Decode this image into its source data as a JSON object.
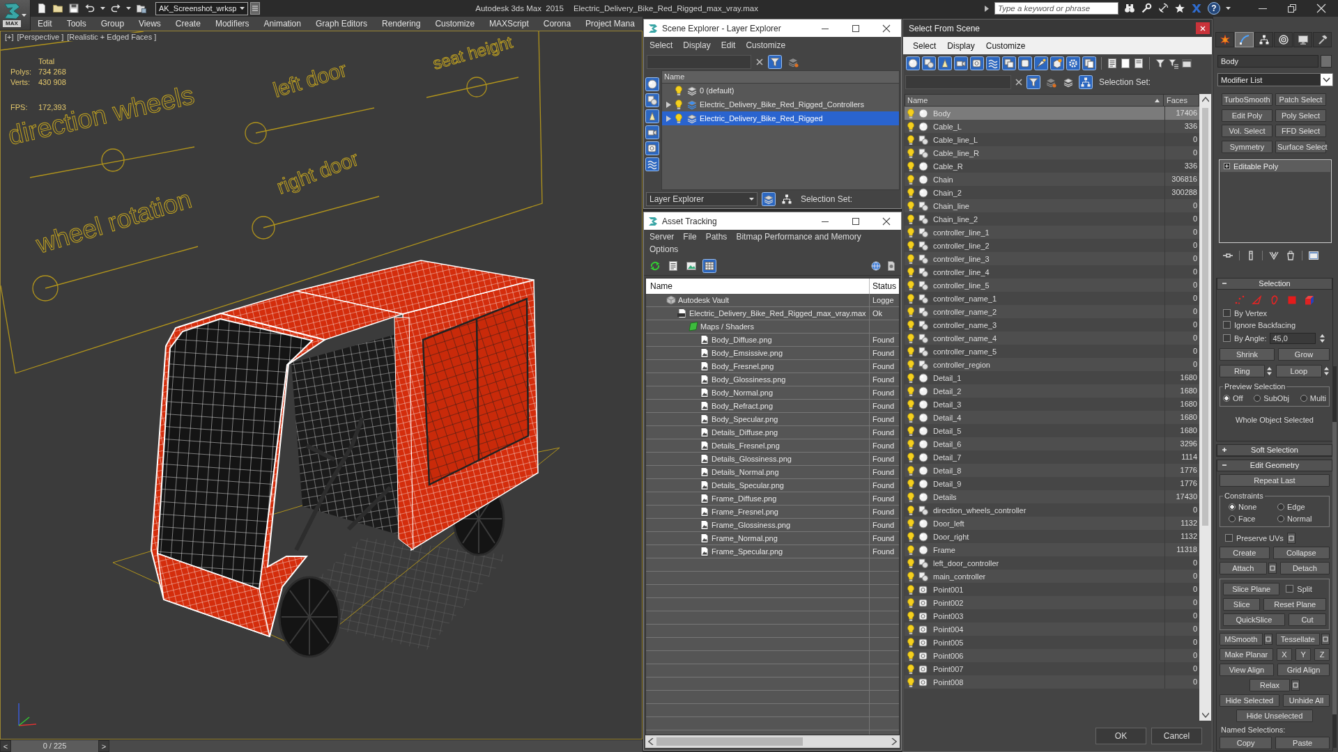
{
  "app_bar": {
    "logo_label": "MAX",
    "workspace": "AK_Screenshot_wrksp",
    "app_title": "Autodesk 3ds Max  2015",
    "file_title": "Electric_Delivery_Bike_Red_Rigged_max_vray.max",
    "search": {
      "placeholder": "Type a keyword or phrase"
    },
    "help": "?"
  },
  "menu": [
    "Edit",
    "Tools",
    "Group",
    "Views",
    "Create",
    "Modifiers",
    "Animation",
    "Graph Editors",
    "Rendering",
    "Customize",
    "MAXScript",
    "Corona",
    "Project Mana"
  ],
  "viewport": {
    "labels": [
      "[+]",
      "[Perspective ]",
      "[Realistic + Edged Faces ]"
    ],
    "stats": {
      "heading": "Total",
      "rows": [
        {
          "label": "Polys:",
          "value": "734 268"
        },
        {
          "label": "Verts:",
          "value": "430 908"
        },
        {
          "label": "FPS:",
          "value": "172,393"
        }
      ]
    },
    "scene_controls": [
      {
        "label": "direction wheels"
      },
      {
        "label": "left door"
      },
      {
        "label": "seat height"
      },
      {
        "label": "right door"
      },
      {
        "label": "wheel rotation"
      }
    ]
  },
  "timeline": {
    "previous": "<",
    "frame": "0 / 225",
    "next": ">",
    "level": 0
  },
  "scene_explorer": {
    "title": "Scene Explorer - Layer Explorer",
    "menu": [
      "Select",
      "Display",
      "Edit",
      "Customize"
    ],
    "search_tools": [
      {
        "on": true
      },
      {
        "on": false
      }
    ],
    "side_filters": [
      {
        "on": true
      },
      {
        "on": true
      },
      {
        "on": true
      },
      {
        "on": true
      },
      {
        "on": true
      },
      {
        "on": true
      }
    ],
    "column": "Name",
    "layers": [
      {
        "name": "0 (default)",
        "expandable": false,
        "current": false,
        "selected": false
      },
      {
        "name": "Electric_Delivery_Bike_Red_Rigged_Controllers",
        "expandable": true,
        "current": true,
        "selected": false
      },
      {
        "name": "Electric_Delivery_Bike_Red_Rigged",
        "expandable": true,
        "current": false,
        "selected": true
      }
    ],
    "explorer_mode": "Layer Explorer",
    "bottom_tools": [
      {
        "on": true
      },
      {
        "on": false
      }
    ],
    "selection_set_label": "Selection Set:"
  },
  "asset_tracking": {
    "title": "Asset Tracking",
    "menu_lines": [
      [
        "Server",
        "File",
        "Paths",
        "Bitmap Performance and Memory"
      ],
      [
        "Options"
      ]
    ],
    "toolbar": [
      {
        "on": false
      },
      {
        "on": false
      },
      {
        "on": false
      },
      {
        "on": true
      }
    ],
    "columns": [
      "Name",
      "Status"
    ],
    "assets": [
      {
        "kind": "vault",
        "name": "Autodesk Vault",
        "status": "Logge",
        "children": [
          {
            "kind": "file",
            "name": "Electric_Delivery_Bike_Red_Rigged_max_vray.max",
            "status": "Ok",
            "children": [
              {
                "kind": "folder",
                "name": "Maps / Shaders",
                "children": [
                  {
                    "kind": "bitmap",
                    "name": "Body_Diffuse.png",
                    "status": "Found"
                  },
                  {
                    "kind": "bitmap",
                    "name": "Body_Emsissive.png",
                    "status": "Found"
                  },
                  {
                    "kind": "bitmap",
                    "name": "Body_Fresnel.png",
                    "status": "Found"
                  },
                  {
                    "kind": "bitmap",
                    "name": "Body_Glossiness.png",
                    "status": "Found"
                  },
                  {
                    "kind": "bitmap",
                    "name": "Body_Normal.png",
                    "status": "Found"
                  },
                  {
                    "kind": "bitmap",
                    "name": "Body_Refract.png",
                    "status": "Found"
                  },
                  {
                    "kind": "bitmap",
                    "name": "Body_Specular.png",
                    "status": "Found"
                  },
                  {
                    "kind": "bitmap",
                    "name": "Details_Diffuse.png",
                    "status": "Found"
                  },
                  {
                    "kind": "bitmap",
                    "name": "Details_Fresnel.png",
                    "status": "Found"
                  },
                  {
                    "kind": "bitmap",
                    "name": "Details_Glossiness.png",
                    "status": "Found"
                  },
                  {
                    "kind": "bitmap",
                    "name": "Details_Normal.png",
                    "status": "Found"
                  },
                  {
                    "kind": "bitmap",
                    "name": "Details_Specular.png",
                    "status": "Found"
                  },
                  {
                    "kind": "bitmap",
                    "name": "Frame_Diffuse.png",
                    "status": "Found"
                  },
                  {
                    "kind": "bitmap",
                    "name": "Frame_Fresnel.png",
                    "status": "Found"
                  },
                  {
                    "kind": "bitmap",
                    "name": "Frame_Glossiness.png",
                    "status": "Found"
                  },
                  {
                    "kind": "bitmap",
                    "name": "Frame_Normal.png",
                    "status": "Found"
                  },
                  {
                    "kind": "bitmap",
                    "name": "Frame_Specular.png",
                    "status": "Found"
                  }
                ]
              }
            ]
          }
        ]
      }
    ]
  },
  "select_from_scene": {
    "title": "Select From Scene",
    "menu": [
      "Select",
      "Display",
      "Customize"
    ],
    "filters": [
      {
        "on": true
      },
      {
        "on": true
      },
      {
        "on": true
      },
      {
        "on": true
      },
      {
        "on": true
      },
      {
        "on": true
      },
      {
        "on": true
      },
      {
        "on": true
      },
      {
        "on": true
      },
      {
        "on": true
      },
      {
        "on": true
      },
      {
        "on": true
      }
    ],
    "search_tools": [
      {
        "on": true
      },
      {
        "on": false
      },
      {
        "on": false
      },
      {
        "on": true
      }
    ],
    "selection_set_label": "Selection Set:",
    "columns": [
      {
        "label": "Name",
        "sorted": true
      },
      {
        "label": "Faces",
        "sorted": false
      }
    ],
    "objects": [
      {
        "kind": "geometry",
        "name": "Body",
        "faces": "17406",
        "selected": true
      },
      {
        "kind": "geometry",
        "name": "Cable_L",
        "faces": "336",
        "selected": false
      },
      {
        "kind": "shape",
        "name": "Cable_line_L",
        "faces": "0",
        "selected": false
      },
      {
        "kind": "shape",
        "name": "Cable_line_R",
        "faces": "0",
        "selected": false
      },
      {
        "kind": "geometry",
        "name": "Cable_R",
        "faces": "336",
        "selected": false
      },
      {
        "kind": "geometry",
        "name": "Chain",
        "faces": "306816",
        "selected": false
      },
      {
        "kind": "geometry",
        "name": "Chain_2",
        "faces": "300288",
        "selected": false
      },
      {
        "kind": "shape",
        "name": "Chain_line",
        "faces": "0",
        "selected": false
      },
      {
        "kind": "shape",
        "name": "Chain_line_2",
        "faces": "0",
        "selected": false
      },
      {
        "kind": "shape",
        "name": "controller_line_1",
        "faces": "0",
        "selected": false
      },
      {
        "kind": "shape",
        "name": "controller_line_2",
        "faces": "0",
        "selected": false
      },
      {
        "kind": "shape",
        "name": "controller_line_3",
        "faces": "0",
        "selected": false
      },
      {
        "kind": "shape",
        "name": "controller_line_4",
        "faces": "0",
        "selected": false
      },
      {
        "kind": "shape",
        "name": "controller_line_5",
        "faces": "0",
        "selected": false
      },
      {
        "kind": "shape",
        "name": "controller_name_1",
        "faces": "0",
        "selected": false
      },
      {
        "kind": "shape",
        "name": "controller_name_2",
        "faces": "0",
        "selected": false
      },
      {
        "kind": "shape",
        "name": "controller_name_3",
        "faces": "0",
        "selected": false
      },
      {
        "kind": "shape",
        "name": "controller_name_4",
        "faces": "0",
        "selected": false
      },
      {
        "kind": "shape",
        "name": "controller_name_5",
        "faces": "0",
        "selected": false
      },
      {
        "kind": "shape",
        "name": "controller_region",
        "faces": "0",
        "selected": false
      },
      {
        "kind": "geometry",
        "name": "Detail_1",
        "faces": "1680",
        "selected": false
      },
      {
        "kind": "geometry",
        "name": "Detail_2",
        "faces": "1680",
        "selected": false
      },
      {
        "kind": "geometry",
        "name": "Detail_3",
        "faces": "1680",
        "selected": false
      },
      {
        "kind": "geometry",
        "name": "Detail_4",
        "faces": "1680",
        "selected": false
      },
      {
        "kind": "geometry",
        "name": "Detail_5",
        "faces": "1680",
        "selected": false
      },
      {
        "kind": "geometry",
        "name": "Detail_6",
        "faces": "3296",
        "selected": false
      },
      {
        "kind": "geometry",
        "name": "Detail_7",
        "faces": "1114",
        "selected": false
      },
      {
        "kind": "geometry",
        "name": "Detail_8",
        "faces": "1776",
        "selected": false
      },
      {
        "kind": "geometry",
        "name": "Detail_9",
        "faces": "1776",
        "selected": false
      },
      {
        "kind": "geometry",
        "name": "Details",
        "faces": "17430",
        "selected": false
      },
      {
        "kind": "shape",
        "name": "direction_wheels_controller",
        "faces": "0",
        "selected": false
      },
      {
        "kind": "geometry",
        "name": "Door_left",
        "faces": "1132",
        "selected": false
      },
      {
        "kind": "geometry",
        "name": "Door_right",
        "faces": "1132",
        "selected": false
      },
      {
        "kind": "geometry",
        "name": "Frame",
        "faces": "11318",
        "selected": false
      },
      {
        "kind": "shape",
        "name": "left_door_controller",
        "faces": "0",
        "selected": false
      },
      {
        "kind": "shape",
        "name": "main_controller",
        "faces": "0",
        "selected": false
      },
      {
        "kind": "helper",
        "name": "Point001",
        "faces": "0",
        "selected": false
      },
      {
        "kind": "helper",
        "name": "Point002",
        "faces": "0",
        "selected": false
      },
      {
        "kind": "helper",
        "name": "Point003",
        "faces": "0",
        "selected": false
      },
      {
        "kind": "helper",
        "name": "Point004",
        "faces": "0",
        "selected": false
      },
      {
        "kind": "helper",
        "name": "Point005",
        "faces": "0",
        "selected": false
      },
      {
        "kind": "helper",
        "name": "Point006",
        "faces": "0",
        "selected": false
      },
      {
        "kind": "helper",
        "name": "Point007",
        "faces": "0",
        "selected": false
      },
      {
        "kind": "helper",
        "name": "Point008",
        "faces": "0",
        "selected": false
      }
    ],
    "buttons": [
      "OK",
      "Cancel"
    ]
  },
  "command_panel": {
    "tabs": [
      {
        "selected": false
      },
      {
        "selected": true
      },
      {
        "selected": false
      },
      {
        "selected": false
      },
      {
        "selected": false
      },
      {
        "selected": false
      }
    ],
    "object_name": "Body",
    "modifier_list": "Modifier List",
    "modifier_buttons": [
      "TurboSmooth",
      "Patch Select",
      "Edit Poly",
      "Poly Select",
      "Vol. Select",
      "FFD Select",
      "Symmetry",
      "Surface Select"
    ],
    "stack": [
      {
        "name": "Editable Poly",
        "expanded": false
      }
    ],
    "selection": {
      "title": "Selection",
      "expanded": true,
      "levels": [
        {
          "kind": "vertex"
        },
        {
          "kind": "edge"
        },
        {
          "kind": "border"
        },
        {
          "kind": "polygon"
        },
        {
          "kind": "element"
        }
      ],
      "options": [
        {
          "label": "By Vertex",
          "checked": false
        },
        {
          "label": "Ignore Backfacing",
          "checked": false
        }
      ],
      "by_angle": {
        "label": "By Angle:",
        "checked": false,
        "value": "45,0"
      },
      "button_rows": [
        [
          {
            "label": "Shrink"
          },
          {
            "label": "Grow"
          }
        ],
        [
          {
            "label": "Ring",
            "spinner": true
          },
          {
            "label": "Loop",
            "spinner": true
          }
        ]
      ],
      "preview": {
        "label": "Preview Selection",
        "options": [
          {
            "label": "Off",
            "selected": true
          },
          {
            "label": "SubObj",
            "selected": false
          },
          {
            "label": "Multi",
            "selected": false
          }
        ]
      },
      "status": "Whole Object Selected"
    },
    "soft_selection": {
      "title": "Soft Selection",
      "expanded": false
    },
    "edit_geometry": {
      "title": "Edit Geometry",
      "expanded": true,
      "repeat": "Repeat Last",
      "constraints": {
        "label": "Constraints",
        "options": [
          {
            "label": "None",
            "selected": true
          },
          {
            "label": "Edge",
            "selected": false
          },
          {
            "label": "Face",
            "selected": false
          },
          {
            "label": "Normal",
            "selected": false
          }
        ]
      },
      "preserve_uvs": {
        "label": "Preserve UVs",
        "checked": false,
        "settings": true
      },
      "rows": [
        [
          {
            "kind": "button",
            "label": "Create"
          },
          {
            "kind": "button",
            "label": "Collapse"
          }
        ],
        [
          {
            "kind": "button",
            "label": "Attach",
            "settings": true
          },
          {
            "kind": "button",
            "label": "Detach"
          }
        ]
      ],
      "slice_rows": [
        [
          {
            "kind": "button",
            "label": "Slice Plane"
          },
          {
            "kind": "checkbox",
            "label": "Split",
            "checked": false
          }
        ],
        [
          {
            "kind": "button",
            "label": "Slice"
          },
          {
            "kind": "button",
            "label": "Reset Plane"
          }
        ],
        [
          {
            "kind": "button",
            "label": "QuickSlice"
          },
          {
            "kind": "button",
            "label": "Cut"
          }
        ]
      ],
      "more_rows": [
        [
          {
            "kind": "button",
            "label": "MSmooth",
            "settings": true
          },
          {
            "kind": "button",
            "label": "Tessellate",
            "settings": true
          }
        ],
        [
          {
            "kind": "button",
            "label": "Make Planar"
          },
          {
            "kind": "button",
            "label": "X"
          },
          {
            "kind": "button",
            "label": "Y"
          },
          {
            "kind": "button",
            "label": "Z"
          }
        ],
        [
          {
            "kind": "button",
            "label": "View Align"
          },
          {
            "kind": "button",
            "label": "Grid Align"
          }
        ],
        [
          {
            "kind": "button",
            "label": "Relax",
            "settings": true
          }
        ],
        [
          {
            "kind": "button",
            "label": "Hide Selected"
          },
          {
            "kind": "button",
            "label": "Unhide All"
          }
        ],
        [
          {
            "kind": "button",
            "label": "Hide Unselected"
          }
        ]
      ],
      "named_selections": {
        "label": "Named Selections:",
        "buttons": [
          "Copy",
          "Paste"
        ]
      }
    }
  }
}
